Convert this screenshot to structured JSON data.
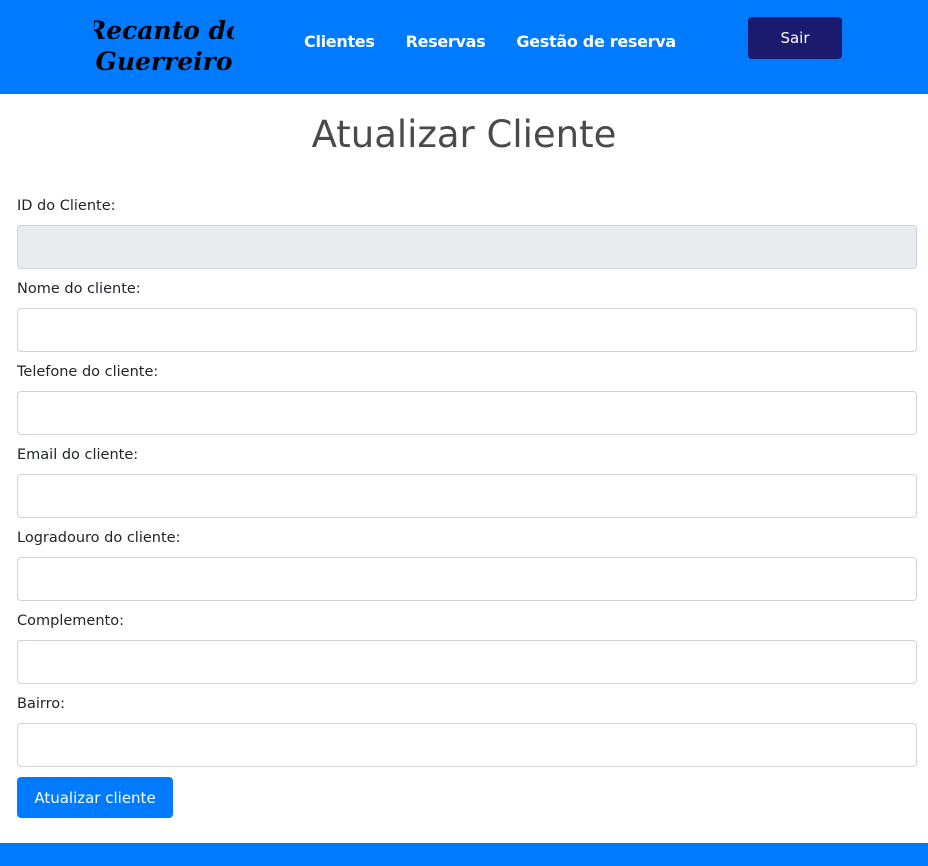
{
  "header": {
    "logo_text": "Recanto do Guerreiro",
    "logo_line1": "Recanto do",
    "logo_line2": "Guerreiro",
    "nav": [
      {
        "label": "Clientes"
      },
      {
        "label": "Reservas"
      },
      {
        "label": "Gestão de reserva"
      }
    ],
    "logout_label": "Sair",
    "color": "#007bff",
    "logout_color": "#1a1a6e"
  },
  "main": {
    "title": "Atualizar Cliente",
    "fields": [
      {
        "label": "ID do Cliente:",
        "value": "",
        "placeholder": "",
        "readonly": true
      },
      {
        "label": "Nome do cliente:",
        "value": "",
        "placeholder": ""
      },
      {
        "label": "Telefone do cliente:",
        "value": "",
        "placeholder": ""
      },
      {
        "label": "Email do cliente:",
        "value": "",
        "placeholder": ""
      },
      {
        "label": "Logradouro do cliente:",
        "value": "",
        "placeholder": ""
      },
      {
        "label": "Complemento:",
        "value": "",
        "placeholder": ""
      },
      {
        "label": "Bairro:",
        "value": "",
        "placeholder": ""
      }
    ],
    "submit_label": "Atualizar cliente"
  }
}
